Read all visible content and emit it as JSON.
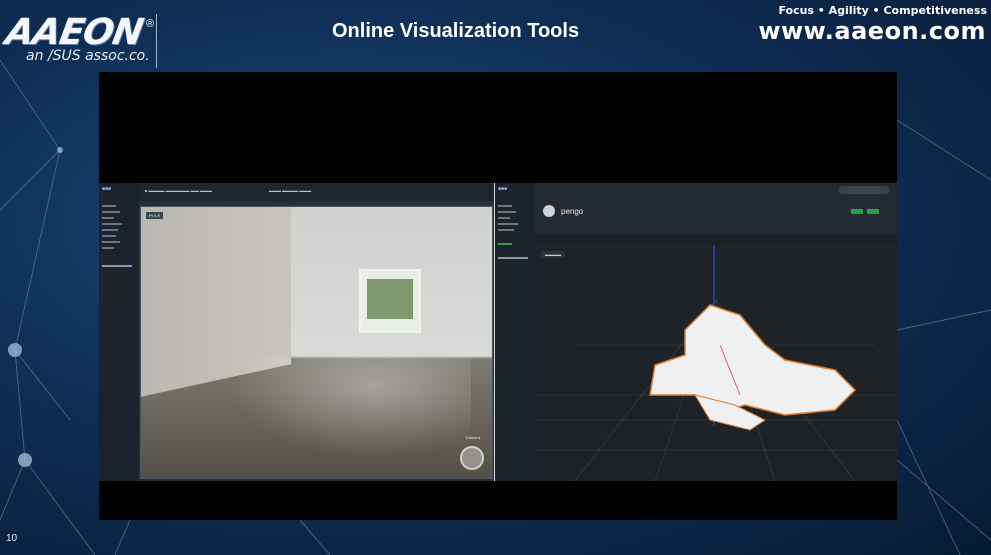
{
  "header": {
    "logo_text": "AAEON",
    "logo_sub": "an /SUS assoc.co.",
    "title": "Online Visualization Tools",
    "tagline": "Focus • Agility • Competitiveness",
    "website": "www.aaeon.com"
  },
  "footer": {
    "page_number": "10"
  },
  "video": {
    "camera": {
      "record_label": "Pt 4-9",
      "overlay_label": "Camera"
    },
    "map": {
      "robot_name": "pengo"
    }
  },
  "colors": {
    "background": "#0f2f57",
    "video_bg": "#000000",
    "accent_green": "#2e9b4e"
  }
}
